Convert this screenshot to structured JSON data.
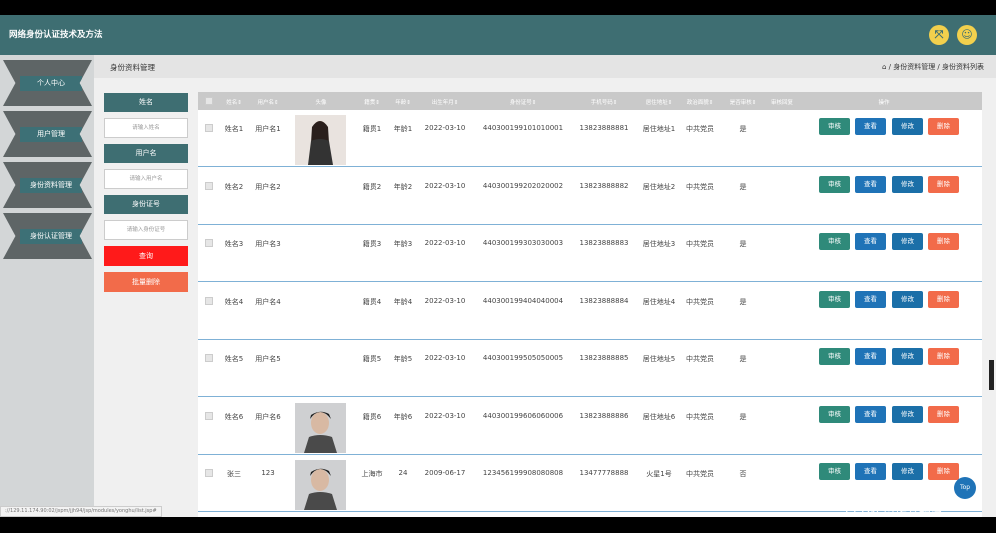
{
  "app": {
    "title": "网络身份认证技术及方法"
  },
  "header_icons": [
    {
      "name": "fullscreen-icon",
      "glyph": "⤧"
    },
    {
      "name": "user-icon",
      "glyph": "☺"
    }
  ],
  "sidebar": {
    "items": [
      {
        "label": "个人中心"
      },
      {
        "label": "用户管理"
      },
      {
        "label": "身份资料管理"
      },
      {
        "label": "身份认证管理"
      }
    ]
  },
  "page": {
    "section_title": "身份资料管理",
    "breadcrumb": "⌂ / 身份资料管理 / 身份资料列表"
  },
  "filters": {
    "name_label": "姓名",
    "name_placeholder": "请输入姓名",
    "username_label": "用户名",
    "username_placeholder": "请输入用户名",
    "idcard_label": "身份证号",
    "idcard_placeholder": "请输入身份证号",
    "query_button": "查询",
    "batch_delete_button": "批量删除"
  },
  "table": {
    "headers": [
      "姓名⇕",
      "用户名⇕",
      "头像",
      "籍贯⇕",
      "年龄⇕",
      "出生年月⇕",
      "身份证号⇕",
      "手机号码⇕",
      "居住地址⇕",
      "政治面貌⇕",
      "是否审核⇕",
      "审核回复",
      "操作"
    ],
    "actions": {
      "review": "审核",
      "view": "查看",
      "edit": "修改",
      "delete": "删除"
    },
    "rows": [
      {
        "name": "姓名1",
        "username": "用户名1",
        "photo": "female",
        "native": "籍贯1",
        "age": "年龄1",
        "birth": "2022-03-10",
        "idcard": "440300199101010001",
        "phone": "13823888881",
        "address": "居住地址1",
        "political": "中共党员",
        "reviewed": "是"
      },
      {
        "name": "姓名2",
        "username": "用户名2",
        "photo": "none",
        "native": "籍贯2",
        "age": "年龄2",
        "birth": "2022-03-10",
        "idcard": "440300199202020002",
        "phone": "13823888882",
        "address": "居住地址2",
        "political": "中共党员",
        "reviewed": "是"
      },
      {
        "name": "姓名3",
        "username": "用户名3",
        "photo": "none",
        "native": "籍贯3",
        "age": "年龄3",
        "birth": "2022-03-10",
        "idcard": "440300199303030003",
        "phone": "13823888883",
        "address": "居住地址3",
        "political": "中共党员",
        "reviewed": "是"
      },
      {
        "name": "姓名4",
        "username": "用户名4",
        "photo": "none",
        "native": "籍贯4",
        "age": "年龄4",
        "birth": "2022-03-10",
        "idcard": "440300199404040004",
        "phone": "13823888884",
        "address": "居住地址4",
        "political": "中共党员",
        "reviewed": "是"
      },
      {
        "name": "姓名5",
        "username": "用户名5",
        "photo": "none",
        "native": "籍贯5",
        "age": "年龄5",
        "birth": "2022-03-10",
        "idcard": "440300199505050005",
        "phone": "13823888885",
        "address": "居住地址5",
        "political": "中共党员",
        "reviewed": "是"
      },
      {
        "name": "姓名6",
        "username": "用户名6",
        "photo": "male",
        "native": "籍贯6",
        "age": "年龄6",
        "birth": "2022-03-10",
        "idcard": "440300199606060006",
        "phone": "13823888886",
        "address": "居住地址6",
        "political": "中共党员",
        "reviewed": "是"
      },
      {
        "name": "张三",
        "username": "123",
        "photo": "male",
        "native": "上海市",
        "age": "24",
        "birth": "2009-06-17",
        "idcard": "123456199908080808",
        "phone": "13477778888",
        "address": "火星1号",
        "political": "中共党员",
        "reviewed": "否"
      }
    ]
  },
  "scroll_top_label": "Top",
  "status_url": "://129.11.174.90:02/jspm/jjh94/jsp/modules/yonghu/list.jsp#",
  "watermark": "CSDN @扬基程序",
  "colors": {
    "primary": "#3e6e72",
    "query": "#ff1a1a",
    "batch": "#f26b4a",
    "review": "#2f8a7a",
    "view": "#1f73b7",
    "edit": "#1b6fa8",
    "delete": "#f26b4a"
  }
}
